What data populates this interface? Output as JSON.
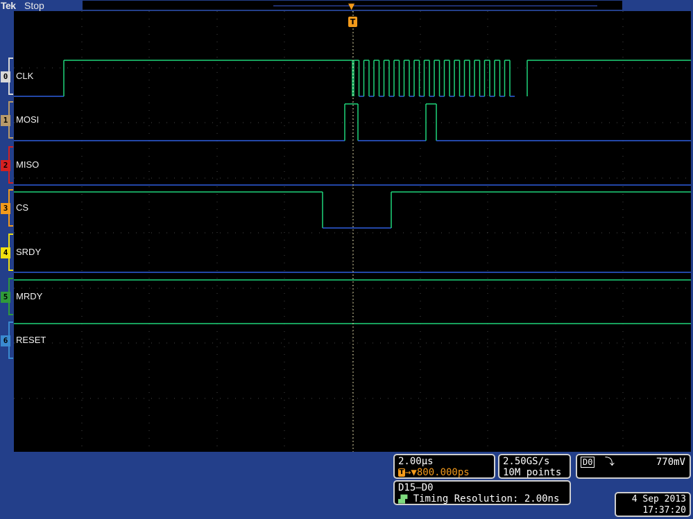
{
  "header": {
    "brand": "Tek",
    "acquisition_state": "Stop"
  },
  "trigger": {
    "marker_label": "T",
    "marker_arrow": "▼"
  },
  "channels": [
    {
      "number": "0",
      "name": "CLK",
      "color": "#d8d8d8"
    },
    {
      "number": "1",
      "name": "MOSI",
      "color": "#b89a6a"
    },
    {
      "number": "2",
      "name": "MISO",
      "color": "#d42020"
    },
    {
      "number": "3",
      "name": "CS",
      "color": "#f39a1b"
    },
    {
      "number": "4",
      "name": "SRDY",
      "color": "#f0e010"
    },
    {
      "number": "5",
      "name": "MRDY",
      "color": "#2f9a3a"
    },
    {
      "number": "6",
      "name": "RESET",
      "color": "#3a8ad0"
    }
  ],
  "colors": {
    "high": "#1fd67a",
    "low": "#2f5fe0",
    "background": "#233f8a",
    "grid": "#555555"
  },
  "horizontal": {
    "scale": "2.00µs",
    "trigger_icon": "T",
    "position": "800.000ps"
  },
  "acquisition": {
    "sample_rate": "2.50GS/s",
    "record_length": "10M points"
  },
  "trigger_readout": {
    "source": "D0",
    "slope_icon": "falling-edge-icon",
    "slope_glyph": "⤵",
    "level": "770mV"
  },
  "digital": {
    "group": "D15–D0",
    "timing_resolution": "Timing Resolution: 2.00ns"
  },
  "datetime": {
    "date": "4 Sep 2013",
    "time": "17:37:20"
  }
}
